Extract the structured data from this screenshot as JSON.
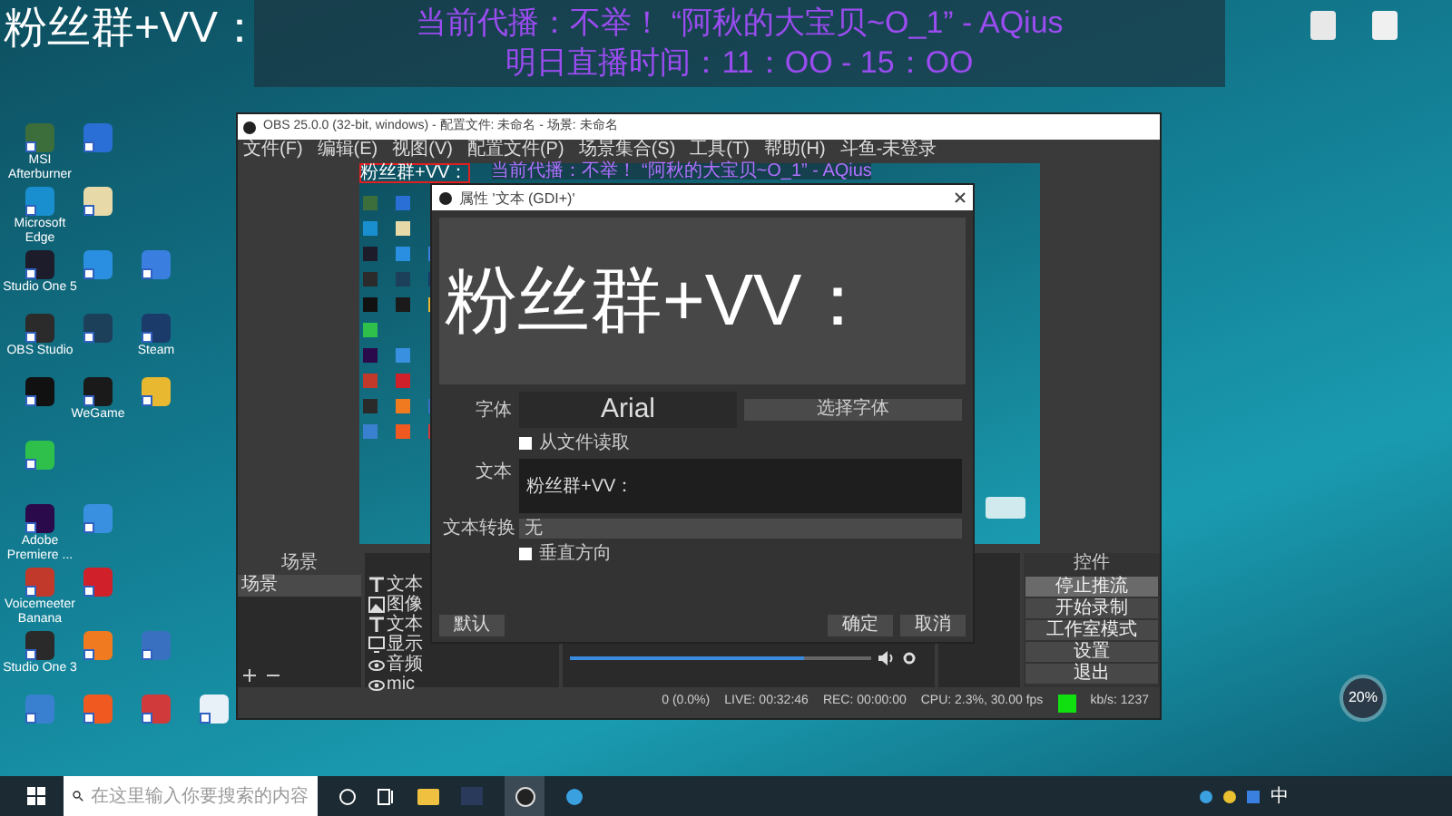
{
  "overlay": {
    "title": "粉丝群+VV：",
    "banner_lines": [
      "当前代播：不举！ “阿秋的大宝贝~O_1” - AQius",
      "明日直播时间：11：OO - 15：OO"
    ]
  },
  "desktop_rows": [
    [
      {
        "label": "MSI Afterburner",
        "color": "#3b6e3b"
      },
      {
        "color": "#2a6fd6"
      }
    ],
    [
      {
        "label": "Microsoft Edge",
        "color": "#1a8fd0"
      },
      {
        "color": "#e8d9a8"
      }
    ],
    [
      {
        "label": "Studio One 5",
        "color": "#1c1c2a"
      },
      {
        "color": "#2a8fe0"
      },
      {
        "color": "#3a7fe0"
      }
    ],
    [
      {
        "label": "OBS Studio",
        "color": "#2b2b2b"
      },
      {
        "color": "#1c3f5a"
      },
      {
        "label": "Steam",
        "color": "#1b3b6a"
      }
    ],
    [
      {
        "color": "#111111"
      },
      {
        "label": "WeGame",
        "color": "#1a1a1a"
      },
      {
        "color": "#e8b830"
      }
    ],
    [
      {
        "color": "#2ec04a"
      }
    ],
    [
      {
        "label": "Adobe Premiere ...",
        "color": "#2a0a4a"
      },
      {
        "color": "#3a90e0"
      }
    ],
    [
      {
        "label": "Voicemeeter Banana",
        "color": "#c0392b"
      },
      {
        "color": "#d0202a"
      }
    ],
    [
      {
        "label": "Studio One 3",
        "color": "#2a2a2a"
      },
      {
        "color": "#f07a20"
      },
      {
        "color": "#3a70c0"
      }
    ],
    [
      {
        "color": "#3a80d0"
      },
      {
        "color": "#f05a20"
      },
      {
        "color": "#d03a3a"
      },
      {
        "color": "#e8f0f8"
      }
    ]
  ],
  "right_icons": [
    {
      "color": "#e8e8e8"
    },
    {
      "color": "#f0f0f0"
    }
  ],
  "obs": {
    "title": "OBS 25.0.0 (32-bit, windows) - 配置文件: 未命名 - 场景: 未命名",
    "menu": [
      "文件(F)",
      "编辑(E)",
      "视图(V)",
      "配置文件(P)",
      "场景集合(S)",
      "工具(T)",
      "帮助(H)",
      "斗鱼-未登录"
    ],
    "preview": {
      "selected_text": "粉丝群+VV：",
      "banner_text": "当前代播：不举！ “阿秋的大宝贝~O_1” - AQius"
    },
    "scenes": {
      "title": "场景",
      "items": [
        {
          "label": "场景",
          "selected": true
        }
      ]
    },
    "sources": [
      {
        "kind": "text",
        "label": "文本"
      },
      {
        "kind": "image",
        "label": "图像"
      },
      {
        "kind": "text",
        "label": "文本"
      },
      {
        "kind": "monitor",
        "label": "显示"
      },
      {
        "kind": "audio",
        "label": "音频"
      },
      {
        "kind": "audio",
        "label": "mic"
      }
    ],
    "mixer": {
      "level": 0.78
    },
    "controls": {
      "title": "控件",
      "buttons": [
        {
          "label": "停止推流",
          "active": true
        },
        {
          "label": "开始录制",
          "active": false
        },
        {
          "label": "工作室模式",
          "active": false
        },
        {
          "label": "设置",
          "active": false
        },
        {
          "label": "退出",
          "active": false
        }
      ]
    },
    "status": [
      "0 (0.0%)",
      "LIVE: 00:32:46",
      "REC: 00:00:00",
      "CPU: 2.3%, 30.00 fps",
      "kb/s: 1237"
    ]
  },
  "dialog": {
    "title": "属性 '文本 (GDI+)'",
    "preview_text": "粉丝群+VV：",
    "font_label": "字体",
    "font_value": "Arial",
    "font_button": "选择字体",
    "from_file": {
      "label": "从文件读取",
      "checked": false
    },
    "text_label": "文本",
    "text_value": "粉丝群+VV：",
    "transform_label": "文本转换",
    "transform_value": "无",
    "vertical": {
      "label": "垂直方向",
      "checked": false
    },
    "buttons": [
      "默认",
      "确定",
      "取消"
    ]
  },
  "taskbar": {
    "search_placeholder": "在这里输入你要搜索的内容",
    "ime": "中"
  },
  "perf_widget": {
    "value": "20%"
  }
}
